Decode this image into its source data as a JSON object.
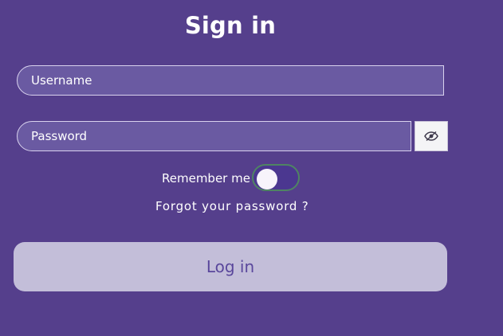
{
  "header": {
    "title": "Sign in"
  },
  "form": {
    "username_placeholder": "Username",
    "password_placeholder": "Password",
    "password_toggle_icon": "eye-slash-icon",
    "remember_label": "Remember me",
    "remember_checked": false,
    "forgot_link": "Forgot your password ?",
    "login_button": "Log in"
  },
  "colors": {
    "background": "#553f8c",
    "field_fill": "#6a5aa2",
    "button_fill": "#c3bed9",
    "button_text": "#5a479c",
    "toggle_border": "#4f8463"
  }
}
